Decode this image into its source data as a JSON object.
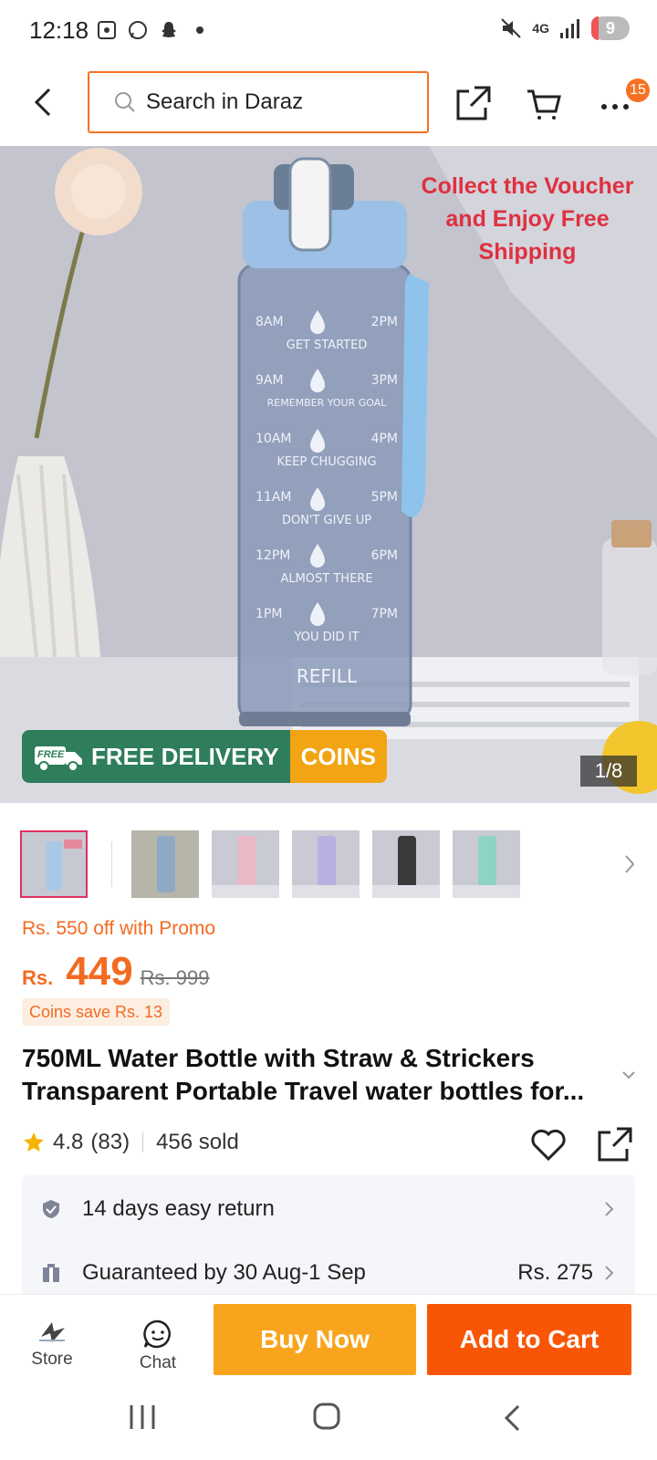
{
  "status_bar": {
    "time": "12:18",
    "network": "4G",
    "battery": "9"
  },
  "top_nav": {
    "search_placeholder": "Search in Daraz",
    "cart_badge": "15"
  },
  "hero": {
    "voucher_line1": "Collect the Voucher",
    "voucher_line2": "and Enjoy Free",
    "voucher_line3": "Shipping",
    "free_badge": "FREE",
    "delivery_label": "FREE DELIVERY",
    "coins_label": "COINS",
    "page_indicator": "1/8",
    "bottle_marks": [
      {
        "left": "8AM",
        "right": "2PM",
        "caption": "GET STARTED"
      },
      {
        "left": "9AM",
        "right": "3PM",
        "caption": "REMEMBER YOUR GOAL"
      },
      {
        "left": "10AM",
        "right": "4PM",
        "caption": "KEEP CHUGGING"
      },
      {
        "left": "11AM",
        "right": "5PM",
        "caption": "DON'T GIVE UP"
      },
      {
        "left": "12PM",
        "right": "6PM",
        "caption": "ALMOST THERE"
      },
      {
        "left": "1PM",
        "right": "7PM",
        "caption": "YOU DID IT"
      }
    ],
    "refill": "REFILL"
  },
  "thumbnails": [
    {
      "color": "#a9c8e6"
    },
    {
      "color": "#8fa9c4"
    },
    {
      "color": "#e9b9c6"
    },
    {
      "color": "#b8b0e0"
    },
    {
      "color": "#3a3a3a"
    },
    {
      "color": "#8fd3c4"
    }
  ],
  "price": {
    "promo": "Rs. 550 off with Promo",
    "currency": "Rs.",
    "value": "449",
    "old": "Rs. 999",
    "coins_save": "Coins save Rs. 13"
  },
  "product": {
    "title_line1": "750ML Water Bottle with Straw & Strickers",
    "title_line2": "Transparent Portable Travel water bottles for..."
  },
  "rating": {
    "score": "4.8",
    "count": "(83)",
    "sold": "456 sold"
  },
  "info": {
    "return_label": "14 days easy return",
    "delivery_label": "Guaranteed by 30 Aug-1 Sep",
    "delivery_price": "Rs. 275"
  },
  "actions": {
    "store_label": "Store",
    "chat_label": "Chat",
    "buy_now": "Buy Now",
    "add_to_cart": "Add to Cart"
  },
  "colors": {
    "accent": "#f57224",
    "buy_now": "#f8a51d",
    "add_to_cart": "#f85606",
    "voucher_text": "#e03040",
    "delivery_green": "#2e7d5b"
  }
}
